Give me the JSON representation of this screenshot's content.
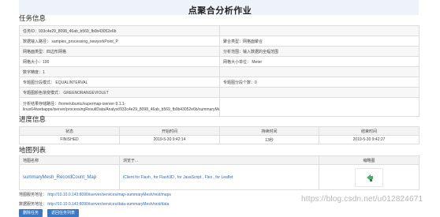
{
  "page": {
    "title": "点聚合分析作业"
  },
  "task_info": {
    "heading": "任务信息",
    "rows": [
      [
        "任务ID：933c4e29_8098_46ab_b569_fb0b43052e6b",
        ""
      ],
      [
        "数据输入路径： samples_processing_newyorkPoint_P",
        "聚合类型：网格面聚合"
      ],
      [
        "网格面类型：四边形网格",
        "分析范围：输入数据的全幅范围"
      ],
      [
        "网格大小：100",
        "网格大小单位： Meter"
      ],
      [
        "数字精度：1",
        ""
      ],
      [
        "专题图分段模式： EQUALINTERVAL",
        "专题图分段个数：0"
      ],
      [
        "专题图颜色渐变模式： GREENORANGEVIOLET",
        ""
      ],
      [
        "分析结果存储路径：/home/ubuntu/supermap-iserver-9.1.1-linux64/webapps/iserver/processingResultData/Analyst/933c4e29_8098_46ab_b569_fb0b43052e6b/summaryMesh.smwu",
        ""
      ]
    ]
  },
  "progress": {
    "heading": "进度信息",
    "columns": [
      "状态",
      "开始时间",
      "持续时间",
      "结束时间"
    ],
    "row": [
      "FINISHED",
      "2019-5-30 9:42:14",
      "13秒",
      "2019-5-30 9:42:27"
    ]
  },
  "map_list": {
    "heading": "地图列表",
    "columns": [
      "地图名称",
      "浏览于...",
      "缩略图"
    ],
    "row": {
      "name": "summaryMesh_RecordCount_Map",
      "links": "iClient for Flash , for Flash3D , for JavaScript , Flex , for Leaflet"
    }
  },
  "services": {
    "map_label": "地图服务地址：",
    "map_url": "http://10.10.0.143:8090/iserver/services/map-summaryMesh/rest/maps",
    "data_label": "数据服务地址：",
    "data_url": "http://10.10.0.143:8090/iserver/services/data-summaryMesh/rest/data"
  },
  "buttons": {
    "delete": "删除任务",
    "back": "返回任务列表"
  },
  "watermark": "https://blog.csdn.net/u012824671",
  "colors": {
    "accent": "#3b78c3",
    "link": "#2a6cc4",
    "thumb_green": "#4cae6e"
  }
}
